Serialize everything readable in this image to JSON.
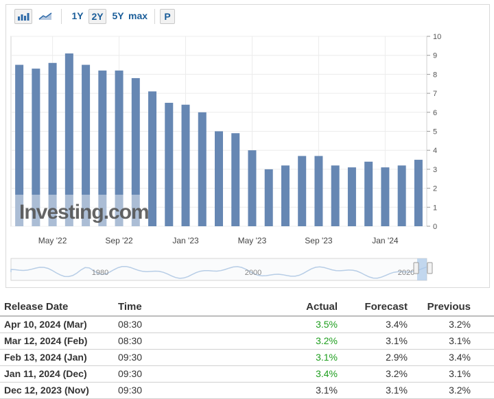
{
  "toolbar": {
    "icons": [
      "bar-chart-icon",
      "area-chart-icon"
    ],
    "ranges": [
      "1Y",
      "2Y",
      "5Y",
      "max"
    ],
    "selected_range": "2Y",
    "p_label": "P"
  },
  "chart_data": {
    "type": "bar",
    "categories": [
      "Mar '22",
      "Apr '22",
      "May '22",
      "Jun '22",
      "Jul '22",
      "Aug '22",
      "Sep '22",
      "Oct '22",
      "Nov '22",
      "Dec '22",
      "Jan '23",
      "Feb '23",
      "Mar '23",
      "Apr '23",
      "May '23",
      "Jun '23",
      "Jul '23",
      "Aug '23",
      "Sep '23",
      "Oct '23",
      "Nov '23",
      "Dec '23",
      "Jan '24",
      "Feb '24",
      "Mar '24"
    ],
    "values": [
      8.5,
      8.3,
      8.6,
      9.1,
      8.5,
      8.2,
      8.2,
      7.8,
      7.1,
      6.5,
      6.4,
      6.0,
      5.0,
      4.9,
      4.0,
      3.0,
      3.2,
      3.7,
      3.7,
      3.2,
      3.1,
      3.4,
      3.1,
      3.2,
      3.5
    ],
    "bar_color": "#6687b3",
    "ylim": [
      0,
      10
    ],
    "yticks": [
      0,
      1,
      2,
      3,
      4,
      5,
      6,
      7,
      8,
      9,
      10
    ],
    "xtick_labels": [
      "May '22",
      "Sep '22",
      "Jan '23",
      "May '23",
      "Sep '23",
      "Jan '24"
    ],
    "grid": true,
    "watermark": "Investing.com",
    "navigator_labels": [
      "1980",
      "2000",
      "2020"
    ]
  },
  "table": {
    "headers": [
      "Release Date",
      "Time",
      "Actual",
      "Forecast",
      "Previous"
    ],
    "rows": [
      {
        "date": "Apr 10, 2024 (Mar)",
        "time": "08:30",
        "actual": "3.5%",
        "forecast": "3.4%",
        "previous": "3.2%",
        "actual_beat": true
      },
      {
        "date": "Mar 12, 2024 (Feb)",
        "time": "08:30",
        "actual": "3.2%",
        "forecast": "3.1%",
        "previous": "3.1%",
        "actual_beat": true
      },
      {
        "date": "Feb 13, 2024 (Jan)",
        "time": "09:30",
        "actual": "3.1%",
        "forecast": "2.9%",
        "previous": "3.4%",
        "actual_beat": true
      },
      {
        "date": "Jan 11, 2024 (Dec)",
        "time": "09:30",
        "actual": "3.4%",
        "forecast": "3.2%",
        "previous": "3.1%",
        "actual_beat": true
      },
      {
        "date": "Dec 12, 2023 (Nov)",
        "time": "09:30",
        "actual": "3.1%",
        "forecast": "3.1%",
        "previous": "3.2%",
        "actual_beat": false
      }
    ]
  }
}
